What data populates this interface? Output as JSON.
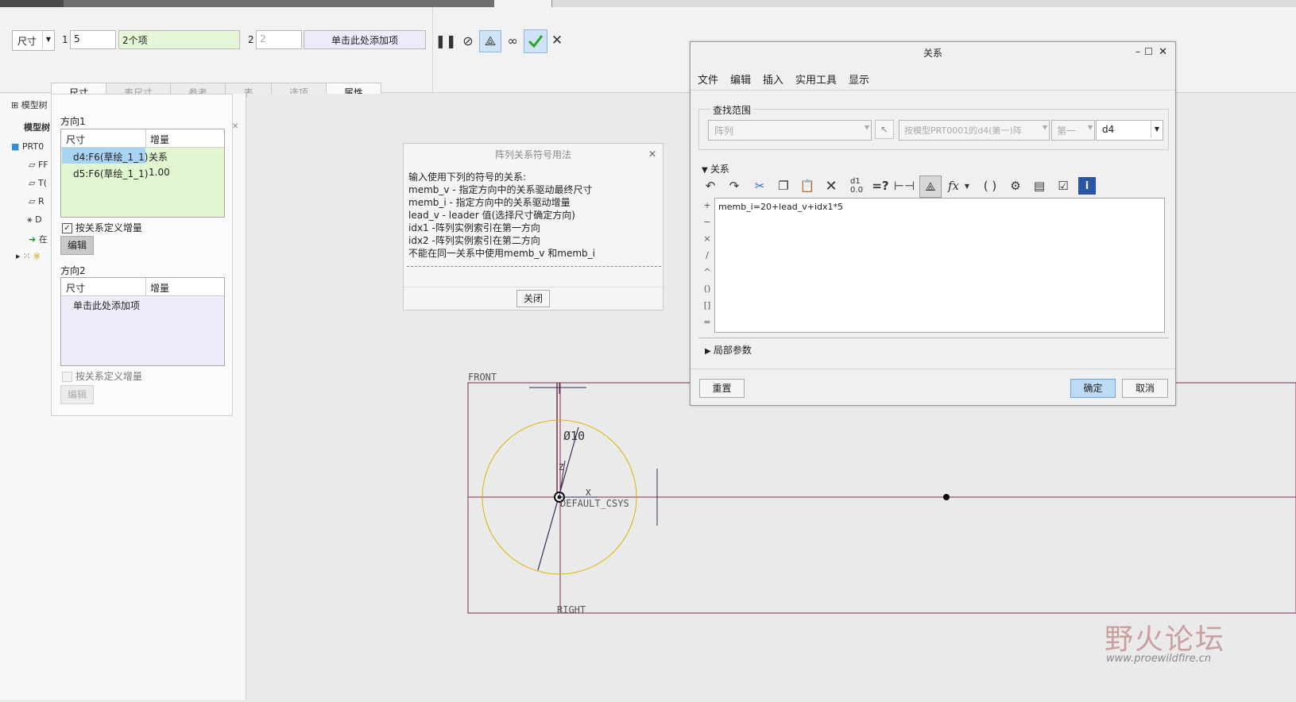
{
  "dashboard": {
    "dim_type": "尺寸",
    "dir1_label": "1",
    "dir1_count": "5",
    "dir1_items": "2个项",
    "dir2_label": "2",
    "dir2_count": "2",
    "dir2_add": "单击此处添加项",
    "tabs": [
      "尺寸",
      "表尺寸",
      "参考",
      "表",
      "选项",
      "属性"
    ]
  },
  "tree": {
    "title": "模型树",
    "header": "模型树",
    "items": [
      "PRT0",
      "FF",
      "T(",
      "R",
      "D",
      "在",
      "※"
    ]
  },
  "dim_panel": {
    "dir1_title": "方向1",
    "col_dim": "尺寸",
    "col_inc": "增量",
    "rows": [
      {
        "dim": "d4:F6(草绘_1_1)",
        "inc": "关系"
      },
      {
        "dim": "d5:F6(草绘_1_1)",
        "inc": "1.00"
      }
    ],
    "check1": "按关系定义增量",
    "edit1": "编辑",
    "dir2_title": "方向2",
    "dir2_placeholder": "单击此处添加项",
    "check2": "按关系定义增量",
    "edit2": "编辑"
  },
  "help_dialog": {
    "title": "阵列关系符号用法",
    "lines": [
      " 输入使用下列的符号的关系:",
      "memb_v - 指定方向中的关系驱动最终尺寸",
      "memb_i - 指定方向中的关系驱动增量",
      "lead_v - leader 值(选择尺寸确定方向)",
      "idx1    -阵列实例索引在第一方向",
      "idx2    -阵列实例索引在第二方向",
      "  不能在同一关系中使用memb_v 和memb_i"
    ],
    "close": "关闭"
  },
  "relations_dialog": {
    "title": "关系",
    "menu": [
      "文件",
      "编辑",
      "插入",
      "实用工具",
      "显示"
    ],
    "scope_label": "查找范围",
    "scope_value": "阵列",
    "scope_model": "按模型PRT0001的d4(第一)阵",
    "scope_dir": "第一",
    "scope_dim": "d4",
    "section": "关系",
    "relation_text": "memb_i=20+lead_v+idx1*5",
    "side_ops": [
      "+",
      "−",
      "×",
      "/",
      "^",
      "()",
      "[]",
      "="
    ],
    "local_params": "局部参数",
    "reset": "重置",
    "ok": "确定",
    "cancel": "取消"
  },
  "sketch": {
    "front": "FRONT",
    "right": "RIGHT",
    "csys": "DEFAULT_CSYS",
    "dim": "Ø10",
    "x": "X",
    "z": "Z"
  },
  "watermark": {
    "cn": "野火论坛",
    "url": "www.proewildfire.cn"
  },
  "colors": {
    "accent": "#cfe3f7",
    "ok_button": "#bcdcf6",
    "circle": "#d8b400",
    "sketch_line": "#7a2d55",
    "check_green": "#2aa52a"
  }
}
